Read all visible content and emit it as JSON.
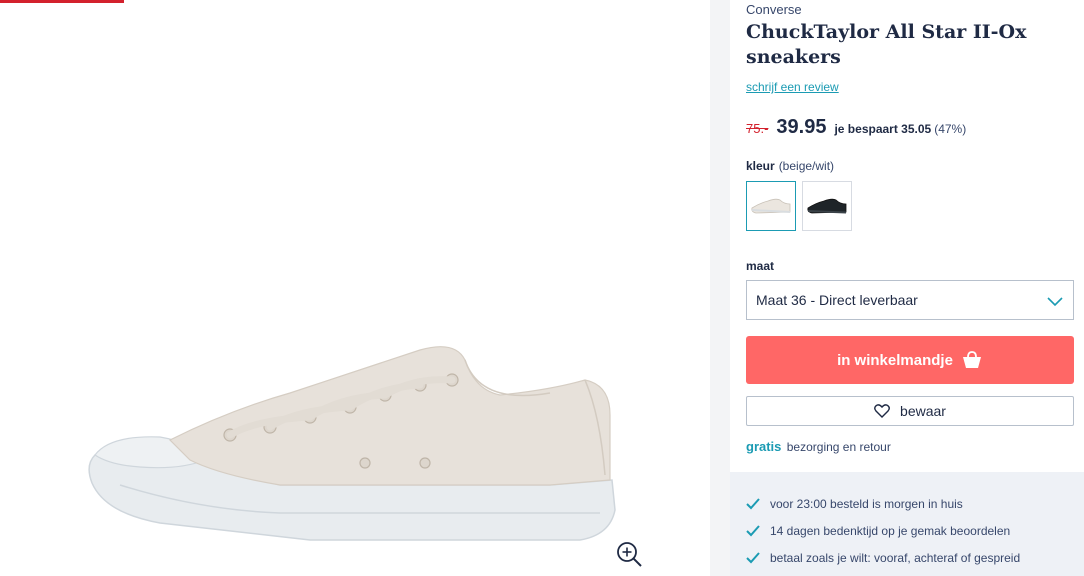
{
  "product": {
    "brand": "Converse",
    "title": "ChuckTaylor All Star II-Ox sneakers",
    "review_link": "schrijf een review"
  },
  "price": {
    "old": "75.-",
    "new": "39.95",
    "savings": "je bespaart 35.05",
    "savings_pct": "(47%)"
  },
  "color": {
    "label": "kleur",
    "selected": "(beige/wit)",
    "options": [
      "beige-wit-sneaker-swatch",
      "black-sneaker-swatch"
    ]
  },
  "size": {
    "label": "maat",
    "selected": "Maat 36 - Direct leverbaar"
  },
  "actions": {
    "cart": "in winkelmandje",
    "save": "bewaar"
  },
  "shipping": {
    "free": "gratis",
    "text": "bezorging en retour"
  },
  "usps": [
    "voor 23:00 besteld is morgen in huis",
    "14 dagen bedenktijd op je gemak beoordelen",
    "betaal zoals je wilt: vooraf, achteraf of gespreid"
  ],
  "colors": {
    "accent": "#1b9bb3",
    "cart": "#ff6766",
    "sale": "#d3212d",
    "text": "#1f2a44"
  }
}
